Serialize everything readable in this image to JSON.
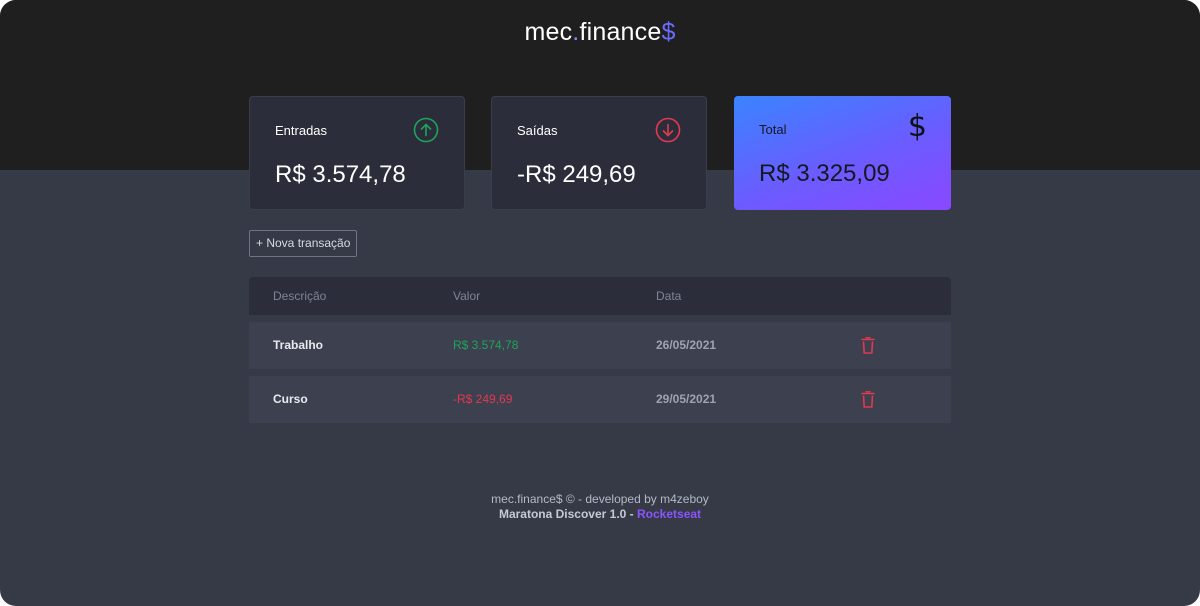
{
  "header": {
    "logo_part1": "mec",
    "logo_dot": ".",
    "logo_part2": "finance",
    "logo_dollar": "$"
  },
  "cards": {
    "income": {
      "title": "Entradas",
      "value": "R$ 3.574,78",
      "icon": "arrow-up-circle-icon",
      "color": "#1fa35b"
    },
    "expense": {
      "title": "Saídas",
      "value": "-R$ 249,69",
      "icon": "arrow-down-circle-icon",
      "color": "#e23950"
    },
    "total": {
      "title": "Total",
      "value": "R$ 3.325,09",
      "icon": "dollar-sign-icon",
      "icon_glyph": "$"
    }
  },
  "new_transaction": {
    "label": "+ Nova transação"
  },
  "table": {
    "headers": [
      "Descrição",
      "Valor",
      "Data"
    ],
    "rows": [
      {
        "description": "Trabalho",
        "amount": "R$ 3.574,78",
        "date": "26/05/2021",
        "type": "income"
      },
      {
        "description": "Curso",
        "amount": "-R$ 249,69",
        "date": "29/05/2021",
        "type": "expense"
      }
    ]
  },
  "footer": {
    "line1": "mec.finance$ © - developed by m4zeboy",
    "line2_text": "Maratona Discover 1.0 - ",
    "line2_brand": "Rocketseat"
  },
  "colors": {
    "header_bg": "#1f1f1f",
    "page_bg": "#363946",
    "accent_blue": "#3a84ff",
    "accent_purple": "#8a48ff",
    "income_green": "#1fa35b",
    "expense_red": "#e23950"
  }
}
